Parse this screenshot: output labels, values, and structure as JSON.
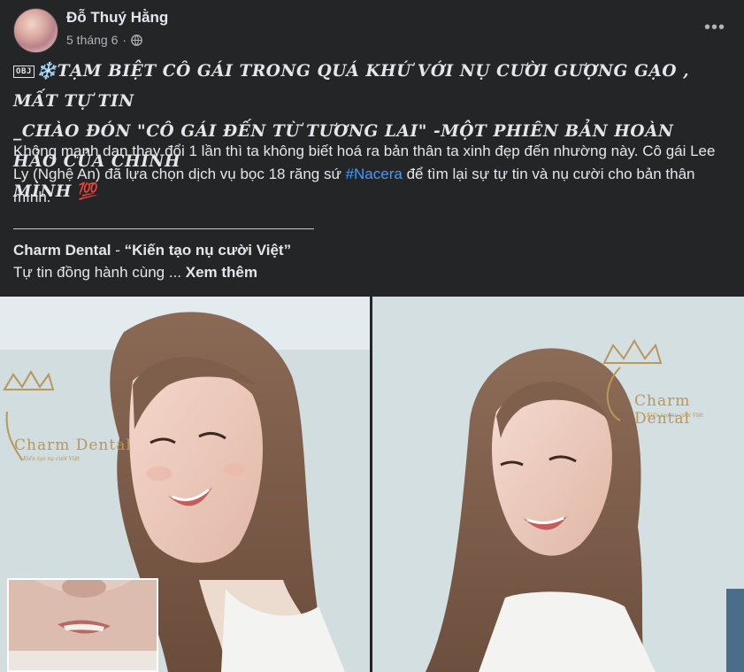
{
  "post": {
    "author": "Đỗ Thuý Hằng",
    "time": "5 tháng 6",
    "separator": "·",
    "privacy_icon": "globe-icon",
    "more_icon": "more-horizontal-icon"
  },
  "headline": {
    "obj_label": "OBJ",
    "decor_emoji": "❄️",
    "line1": "TẠM BIỆT CÔ GÁI TRONG QUÁ KHỨ VỚI NỤ CƯỜI GƯỢNG GẠO , MẤT TỰ TIN",
    "line2": "_CHÀO ĐÓN \"CÔ GÁI ĐẾN TỪ TƯƠNG LAI\" -MỘT PHIÊN BẢN HOÀN HẢO CỦA CHÍNH",
    "line3": "MÌNH",
    "emoji_100": "💯"
  },
  "body": {
    "part1": "Không mạnh dạn thay đổi 1 lần thì ta không biết hoá ra bản thân ta xinh đẹp đến nhường này. Cô gái Lee Ly (Nghệ An) đã lựa chọn dịch vụ bọc 18 răng sứ ",
    "hashtag": "#Nacera",
    "part2": " để tìm lại sự tự tin và nụ cười cho bản thân mình."
  },
  "brand": {
    "name": "Charm Dental",
    "dash": " - ",
    "slogan": "“Kiến tạo nụ cười Việt”"
  },
  "teaser": {
    "text": "Tự tin đồng hành cùng ... ",
    "see_more": "Xem thêm"
  },
  "photos": {
    "left_logo": "Charm Dental",
    "left_logo_sub": "Kiến tạo nụ cười Việt",
    "right_logo": "Charm Dental",
    "right_logo_sub": "Kiến tạo nụ cười Việt"
  },
  "colors": {
    "background": "#242526",
    "text": "#e4e6eb",
    "secondary_text": "#b0b3b8",
    "hashtag": "#4599ff",
    "logo_gold": "#b8975a"
  }
}
